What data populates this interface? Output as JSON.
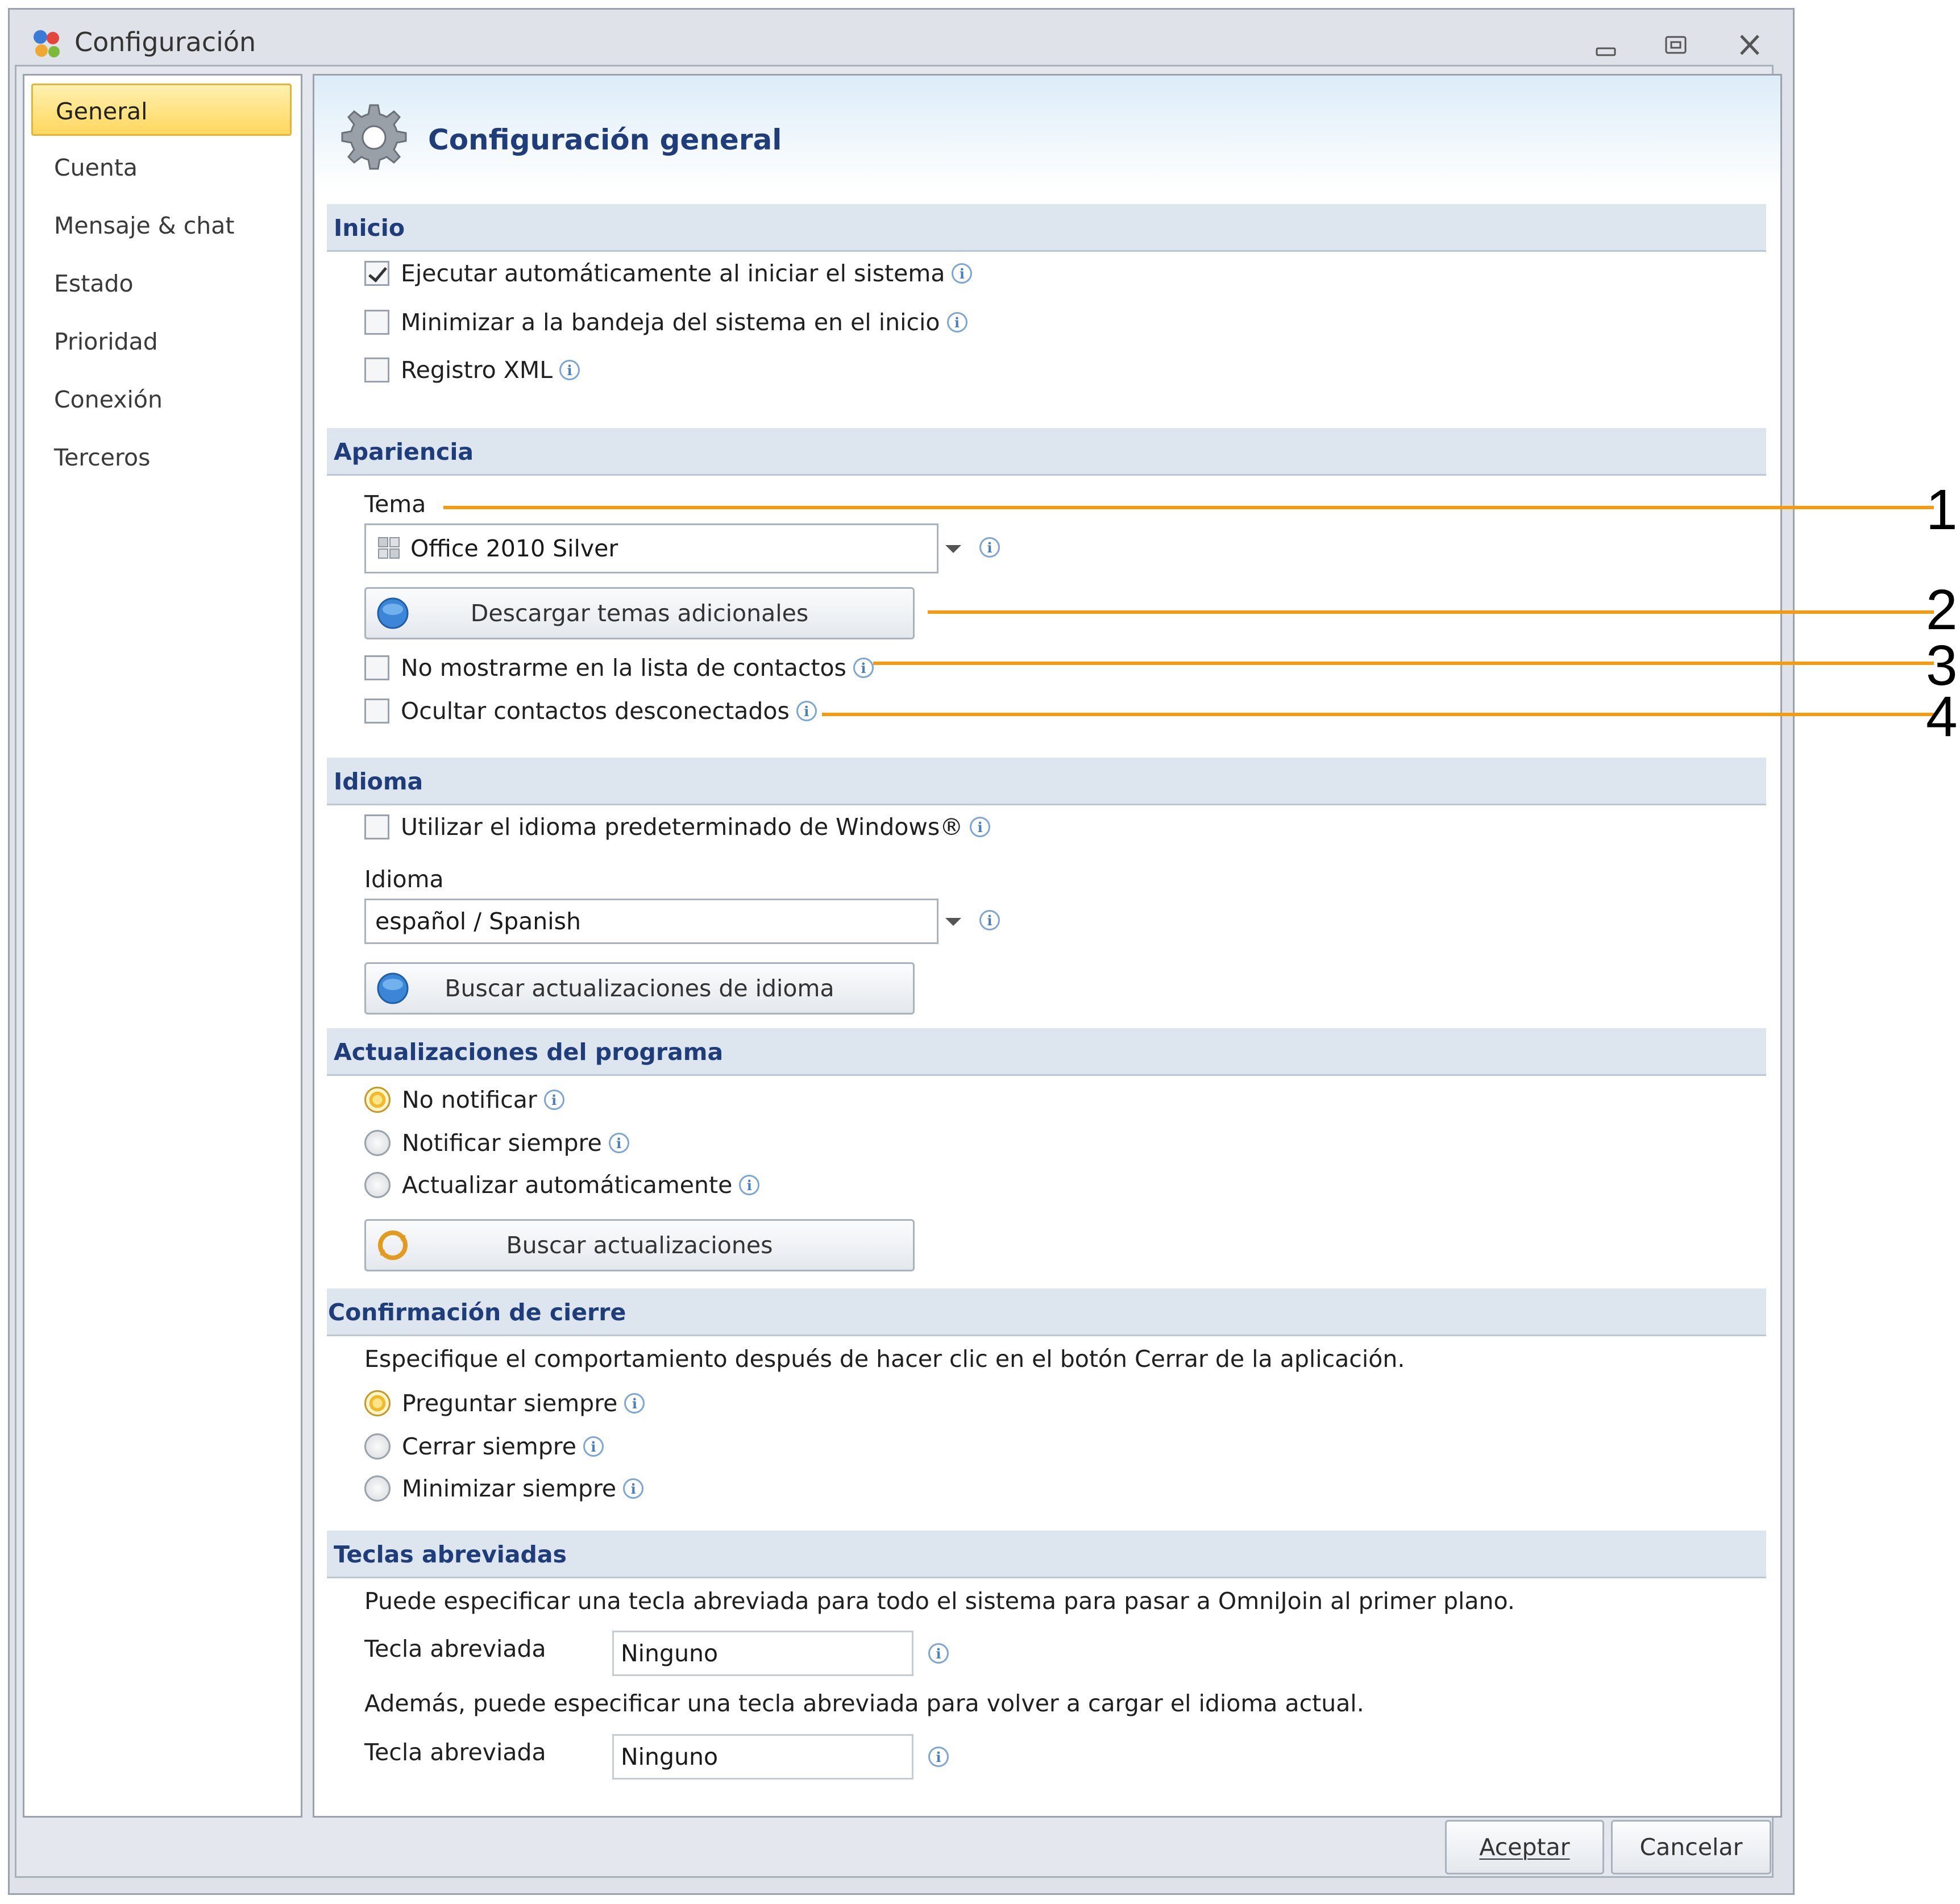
{
  "window": {
    "title": "Configuración"
  },
  "sidebar": {
    "items": [
      {
        "label": "General",
        "active": true
      },
      {
        "label": "Cuenta"
      },
      {
        "label": "Mensaje & chat"
      },
      {
        "label": "Estado"
      },
      {
        "label": "Prioridad"
      },
      {
        "label": "Conexión"
      },
      {
        "label": "Terceros"
      }
    ]
  },
  "page": {
    "title": "Configuración general"
  },
  "inicio": {
    "title": "Inicio",
    "opt_autostart": "Ejecutar automáticamente al iniciar el sistema",
    "opt_autostart_checked": true,
    "opt_minimize": "Minimizar a la bandeja del sistema en el inicio",
    "opt_xml": "Registro XML"
  },
  "apariencia": {
    "title": "Apariencia",
    "tema_label": "Tema",
    "tema_value": "Office 2010 Silver",
    "download_button": "Descargar temas adicionales",
    "opt_hide_me": "No mostrarme en la lista de contactos",
    "opt_hide_offline": "Ocultar contactos desconectados"
  },
  "idioma": {
    "title": "Idioma",
    "opt_windows_lang": "Utilizar el idioma predeterminado de Windows®",
    "idioma_label": "Idioma",
    "idioma_value": "español / Spanish",
    "update_button": "Buscar actualizaciones de idioma"
  },
  "actualizaciones": {
    "title": "Actualizaciones del programa",
    "opt_no_notify": "No notificar",
    "opt_notify_always": "Notificar siempre",
    "opt_auto_update": "Actualizar automáticamente",
    "selected": "No notificar",
    "check_button": "Buscar actualizaciones"
  },
  "cierre": {
    "title": "Confirmación de cierre",
    "description": "Especifique el comportamiento después de hacer clic en el botón Cerrar de la aplicación.",
    "opt_ask": "Preguntar siempre",
    "opt_close": "Cerrar siempre",
    "opt_minimize": "Minimizar siempre",
    "selected": "Preguntar siempre"
  },
  "teclas": {
    "title": "Teclas abreviadas",
    "description1": "Puede especificar una tecla abreviada para todo el sistema para pasar a OmniJoin al primer plano.",
    "hotkey1_label": "Tecla abreviada",
    "hotkey1_value": "Ninguno",
    "description2": "Además, puede especificar una tecla abreviada para volver a cargar el idioma actual.",
    "hotkey2_label": "Tecla abreviada",
    "hotkey2_value": "Ninguno"
  },
  "footer": {
    "ok_button": "Aceptar",
    "cancel_button": "Cancelar"
  },
  "callouts": [
    "1",
    "2",
    "3",
    "4"
  ],
  "colors": {
    "callout": "#f39c12",
    "section_title": "#1f3d7a",
    "active_nav": "#ffd75e"
  }
}
